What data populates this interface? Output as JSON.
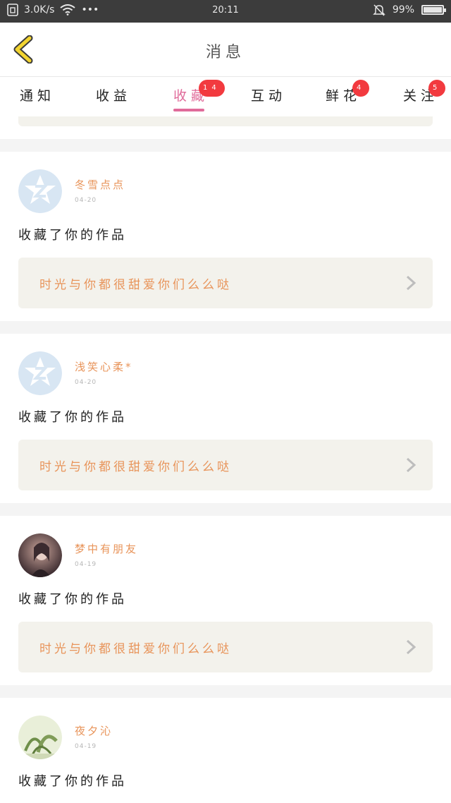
{
  "status_bar": {
    "speed": "3.0K/s",
    "dots": "•••",
    "time": "20:11",
    "battery": "99%",
    "battery_level": 0.99
  },
  "header": {
    "title": "消息"
  },
  "tabs": [
    {
      "label": "通知",
      "badge": ""
    },
    {
      "label": "收益",
      "badge": ""
    },
    {
      "label": "收藏",
      "badge": "14",
      "active": true
    },
    {
      "label": "互动",
      "badge": ""
    },
    {
      "label": "鲜花",
      "badge": "4"
    },
    {
      "label": "关注",
      "badge": "5"
    }
  ],
  "messages": [
    {
      "user": "冬雪点点",
      "date": "04-20",
      "text": "收藏了你的作品",
      "work": "时光与你都很甜爱你们么么哒",
      "avatar": "qq-default-icon"
    },
    {
      "user": "浅笑心柔*",
      "date": "04-20",
      "text": "收藏了你的作品",
      "work": "时光与你都很甜爱你们么么哒",
      "avatar": "qq-default-icon"
    },
    {
      "user": "梦中有朋友",
      "date": "04-19",
      "text": "收藏了你的作品",
      "work": "时光与你都很甜爱你们么么哒",
      "avatar": "photo-avatar"
    },
    {
      "user": "夜夕沁",
      "date": "04-19",
      "text": "收藏了你的作品",
      "work": "",
      "avatar": "plant-avatar"
    }
  ],
  "colors": {
    "accent_pink": "#e06b9a",
    "name_orange": "#e8945a",
    "badge_red": "#f23a3f",
    "back_yellow": "#f2d430"
  }
}
